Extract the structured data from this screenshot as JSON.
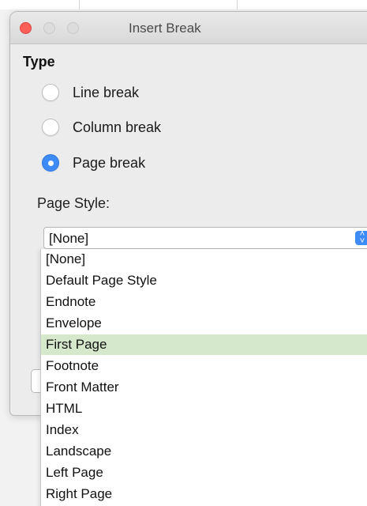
{
  "window": {
    "title": "Insert Break"
  },
  "type_section": {
    "heading": "Type"
  },
  "options": [
    {
      "label": "Line break",
      "checked": false
    },
    {
      "label": "Column break",
      "checked": false
    },
    {
      "label": "Page break",
      "checked": true
    }
  ],
  "page_style": {
    "label": "Page Style:",
    "selected": "[None]",
    "list": [
      "[None]",
      "Default Page Style",
      "Endnote",
      "Envelope",
      "First Page",
      "Footnote",
      "Front Matter",
      "HTML",
      "Index",
      "Landscape",
      "Left Page",
      "Right Page"
    ],
    "highlighted": "First Page"
  },
  "colors": {
    "accent": "#3d8bf7",
    "highlight": "#d6e8cc",
    "close": "#ff5f57"
  }
}
